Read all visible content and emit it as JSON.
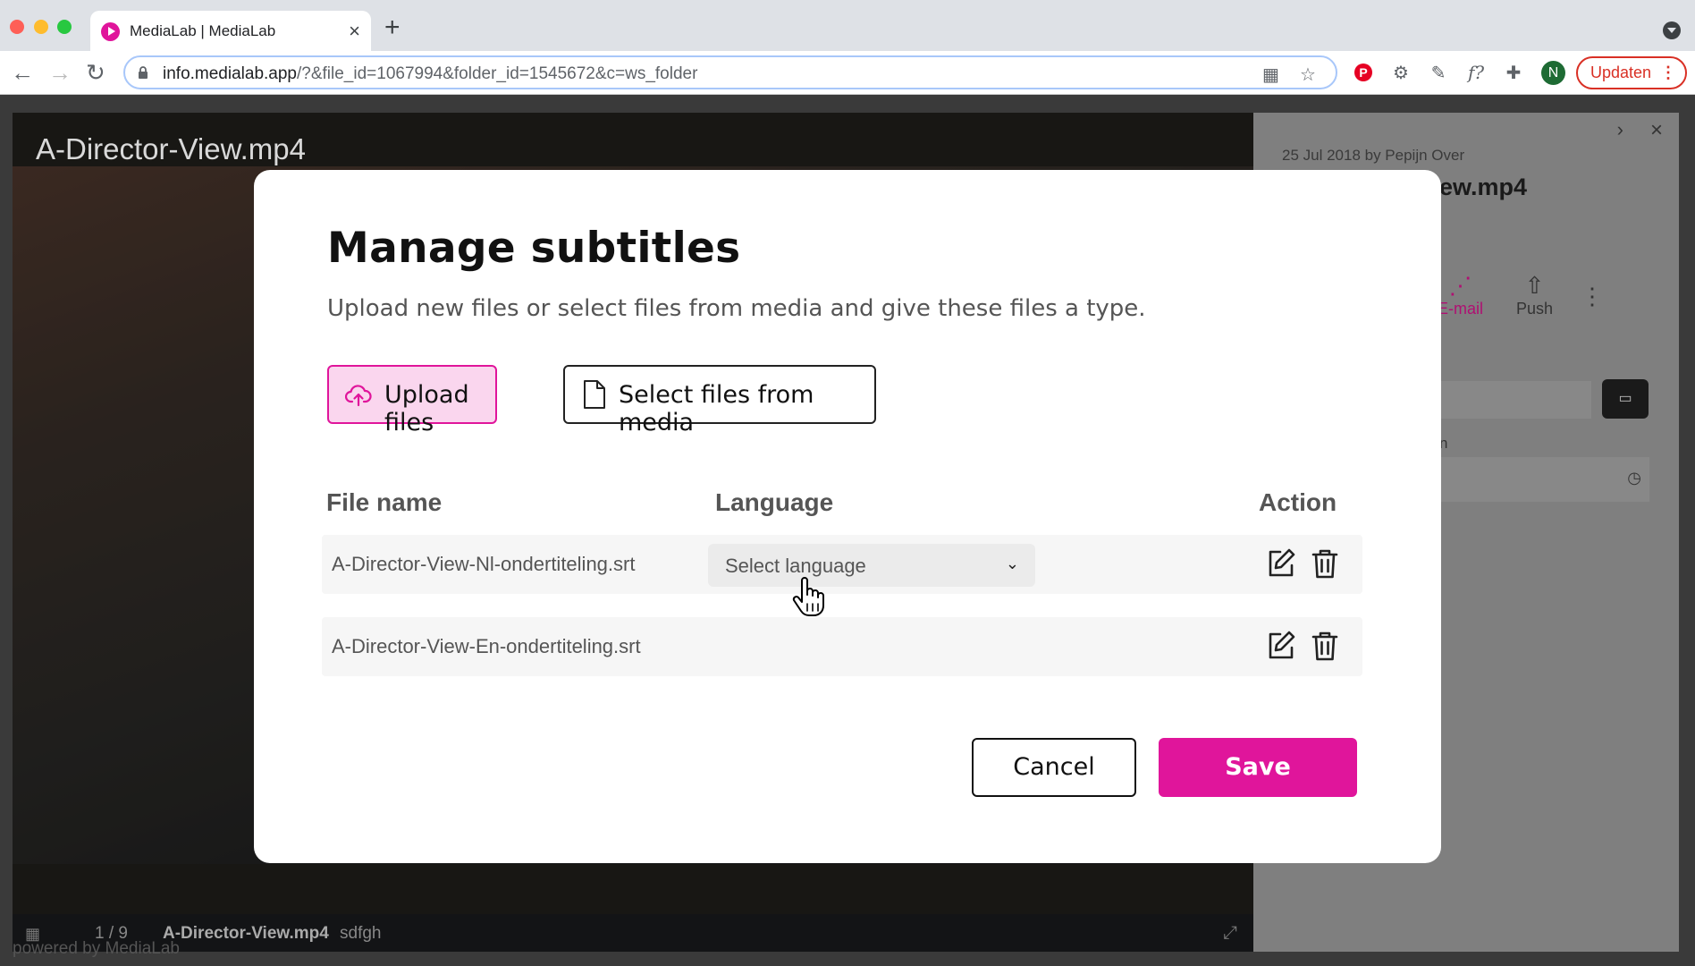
{
  "browser": {
    "tab_title": "MediaLab | MediaLab",
    "url_host": "info.medialab.app",
    "url_path": "/?&file_id=1067994&folder_id=1545672&c=ws_folder",
    "profile_initial": "N",
    "update_label": "Updaten"
  },
  "viewer": {
    "title": "A-Director-View.mp4",
    "counter": "1 / 9",
    "file_name": "A-Director-View.mp4",
    "description": "sdfgh",
    "powered_by": "powered by MediaLab"
  },
  "side_panel": {
    "date": "25 Jul 2018 by Pepijn Over",
    "title_fragment": "ew.mp4",
    "actions": [
      {
        "label": "E-mail",
        "icon": "share-icon",
        "color": "#e0159b"
      },
      {
        "label": "Push",
        "icon": "upload-icon",
        "color": "#333333"
      }
    ],
    "label_fragment": "n"
  },
  "modal": {
    "title": "Manage subtitles",
    "subtitle": "Upload new files or select files from media and give these files a type.",
    "upload_label": "Upload files",
    "media_label": "Select files from media",
    "columns": {
      "file": "File name",
      "language": "Language",
      "action": "Action"
    },
    "rows": [
      {
        "file_name": "A-Director-View-Nl-ondertiteling.srt",
        "language_placeholder": "Select language"
      },
      {
        "file_name": "A-Director-View-En-ondertiteling.srt"
      }
    ],
    "cancel_label": "Cancel",
    "save_label": "Save"
  },
  "colors": {
    "accent": "#e0159b",
    "accent_light": "#fad6ee"
  }
}
